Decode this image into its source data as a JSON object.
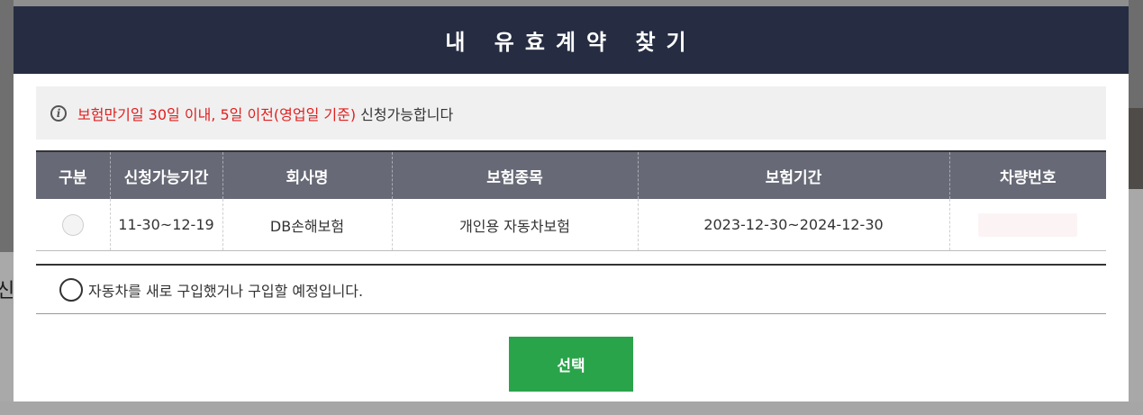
{
  "background": {
    "partial_text": "신청"
  },
  "modal": {
    "title": "내 유효계약 찾기"
  },
  "notice": {
    "icon": "info-icon",
    "highlight_text": "보험만기일 30일 이내, 5일 이전(영업일 기준)",
    "rest_text": " 신청가능합니다"
  },
  "table": {
    "headers": [
      "구분",
      "신청가능기간",
      "회사명",
      "보험종목",
      "보험기간",
      "차량번호"
    ],
    "rows": [
      {
        "period": "11-30~12-19",
        "company": "DB손해보험",
        "type": "개인용 자동차보험",
        "term": "2023-12-30~2024-12-30",
        "plate": ""
      }
    ]
  },
  "new_car_option": {
    "label": "자동차를 새로 구입했거나 구입할 예정입니다."
  },
  "buttons": {
    "select": "선택"
  },
  "colors": {
    "header_bg": "#262d42",
    "table_header_bg": "#676a76",
    "accent_red": "#e02020",
    "button_green": "#2aa44a"
  }
}
